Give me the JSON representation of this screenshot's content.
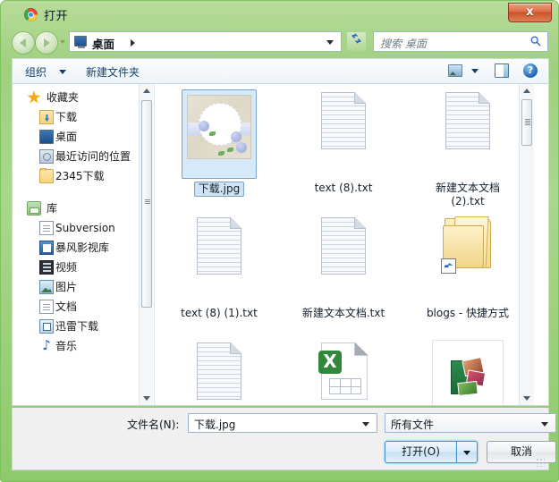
{
  "window": {
    "title": "打开",
    "app_icon": "chrome-icon",
    "close_label": "x"
  },
  "nav": {
    "back_label": "back-arrow",
    "forward_label": "forward-arrow",
    "breadcrumb": "桌面",
    "refresh_label": "↯",
    "search_placeholder": "搜索 桌面"
  },
  "toolbar": {
    "organize_label": "组织",
    "new_folder_label": "新建文件夹",
    "view_icon": "view-icon",
    "preview_pane_icon": "preview-pane-icon",
    "help_label": "?"
  },
  "sidebar": {
    "groups": [
      {
        "header": "收藏夹",
        "header_icon": "star-icon",
        "items": [
          {
            "label": "下载",
            "icon": "download-folder-icon"
          },
          {
            "label": "桌面",
            "icon": "desktop-icon"
          },
          {
            "label": "最近访问的位置",
            "icon": "recent-places-icon"
          },
          {
            "label": "2345下载",
            "icon": "folder-icon"
          }
        ]
      },
      {
        "header": "库",
        "header_icon": "library-icon",
        "items": [
          {
            "label": "Subversion",
            "icon": "document-icon"
          },
          {
            "label": "暴风影视库",
            "icon": "video-library-icon"
          },
          {
            "label": "视频",
            "icon": "film-icon"
          },
          {
            "label": "图片",
            "icon": "picture-icon"
          },
          {
            "label": "文档",
            "icon": "document-icon"
          },
          {
            "label": "迅雷下载",
            "icon": "thunder-download-icon"
          },
          {
            "label": "音乐",
            "icon": "music-note-icon"
          }
        ]
      }
    ]
  },
  "files": [
    {
      "name": "下载.jpg",
      "icon": "image-thumbnail",
      "selected": true
    },
    {
      "name": "text (8).txt",
      "icon": "text-file-icon",
      "selected": false
    },
    {
      "name": "新建文本文档 (2).txt",
      "icon": "text-file-icon",
      "selected": false
    },
    {
      "name": "text (8) (1).txt",
      "icon": "text-file-icon",
      "selected": false
    },
    {
      "name": "新建文本文档.txt",
      "icon": "text-file-icon",
      "selected": false
    },
    {
      "name": "blogs - 快捷方式",
      "icon": "folder-shortcut-icon",
      "selected": false
    },
    {
      "name": "",
      "icon": "text-file-icon",
      "selected": false
    },
    {
      "name": "",
      "icon": "excel-file-icon",
      "selected": false
    },
    {
      "name": "",
      "icon": "photo-app-icon",
      "selected": false
    }
  ],
  "bottom": {
    "filename_label": "文件名(N):",
    "filename_value": "下载.jpg",
    "filetype_value": "所有文件",
    "open_label": "打开(O)",
    "cancel_label": "取消"
  },
  "colors": {
    "frame": "#9ed07e",
    "selection": "#cfe4f6",
    "accent": "#3d94c9",
    "close": "#c95228"
  }
}
